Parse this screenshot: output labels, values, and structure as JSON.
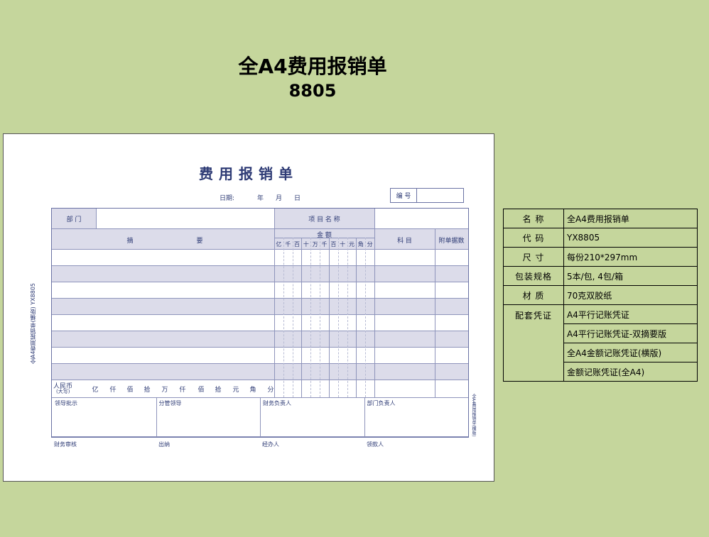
{
  "title": "全A4费用报销单",
  "code": "8805",
  "form": {
    "heading": "费用报销单",
    "date_label": "日期:",
    "year": "年",
    "month": "月",
    "day": "日",
    "no_label": "编 号",
    "dept": "部 门",
    "item_name": "项 目 名 称",
    "summary_a": "摘",
    "summary_b": "要",
    "amount": "金    额",
    "digits": [
      "亿",
      "千",
      "百",
      "十",
      "万",
      "千",
      "百",
      "十",
      "元",
      "角",
      "分"
    ],
    "subject": "科 目",
    "attach": "附单据数",
    "rmb": "人民币",
    "upper": "(大写)",
    "units": [
      "亿",
      "仟",
      "佰",
      "拾",
      "万",
      "仟",
      "佰",
      "拾",
      "元",
      "角",
      "分"
    ],
    "sign_boxes": [
      "领导批示",
      "分管领导",
      "财务负责人",
      "部门负责人"
    ],
    "footer": [
      "财务审核",
      "出纳",
      "经办人",
      "领款人"
    ],
    "side_left": "全A4费用报销单(横版)   YX8805",
    "side_right": "全A4费用报销单(横版)"
  },
  "spec": [
    {
      "k": "名  称",
      "v": [
        "全A4费用报销单"
      ]
    },
    {
      "k": "代  码",
      "v": [
        "YX8805"
      ]
    },
    {
      "k": "尺  寸",
      "v": [
        "每份210*297mm"
      ]
    },
    {
      "k": "包装规格",
      "v": [
        "5本/包, 4包/箱"
      ]
    },
    {
      "k": "材  质",
      "v": [
        "70克双胶纸"
      ]
    },
    {
      "k": "配套凭证",
      "v": [
        "A4平行记账凭证",
        "A4平行记账凭证-双摘要版",
        "全A4金额记账凭证(横版)",
        "金额记账凭证(全A4)"
      ]
    }
  ]
}
